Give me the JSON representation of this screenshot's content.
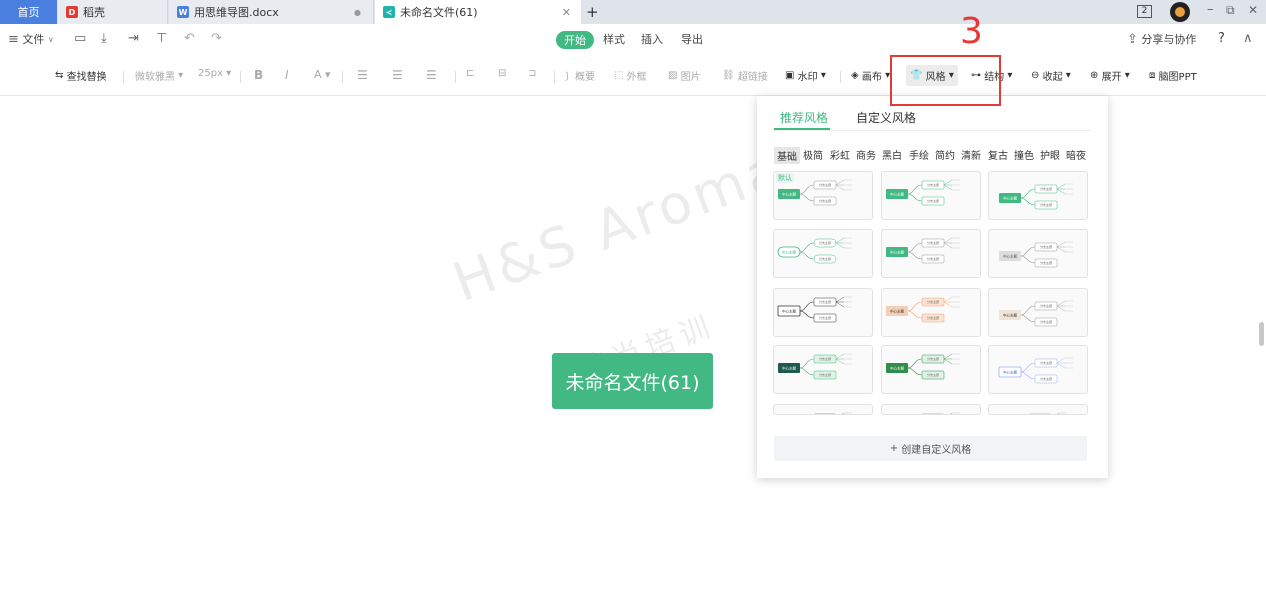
{
  "tabs": {
    "home": "首页",
    "t1": "稻壳",
    "t2": "用思维导图.docx",
    "t3": "未命名文件(61)",
    "new": "+"
  },
  "window": {
    "badge": "2"
  },
  "menu": {
    "file": "文件",
    "start": "开始",
    "style": "样式",
    "insert": "插入",
    "export": "导出",
    "share": "分享与协作",
    "help": "?"
  },
  "toolbar": {
    "find_replace": "查找替换",
    "font": "微软雅黑",
    "size": "25px",
    "bold": "B",
    "italic": "I",
    "color": "A",
    "summary": "概要",
    "frame": "外框",
    "image": "图片",
    "link": "超链接",
    "watermark": "水印",
    "canvas": "画布",
    "style": "风格",
    "structure": "结构",
    "collapse": "收起",
    "expand": "展开",
    "ppt": "脑图PPT"
  },
  "canvas": {
    "center_node": "未命名文件(61)",
    "watermark": "H&S Aroma",
    "watermark2": "芳尚培训"
  },
  "panel": {
    "tab_recommended": "推荐风格",
    "tab_custom": "自定义风格",
    "categories": [
      "基础",
      "极简",
      "彩虹",
      "商务",
      "黑白",
      "手绘",
      "简约",
      "清新",
      "复古",
      "撞色",
      "护眼",
      "暗夜"
    ],
    "default_label": "默认",
    "create_button": "创建自定义风格",
    "node_text": "中心主题",
    "branch_text": "分支主题"
  },
  "annotation": {
    "number": "3",
    "color": "#e53935"
  },
  "colors": {
    "accent": "#42b883",
    "tab_home": "#4a7fe0"
  }
}
